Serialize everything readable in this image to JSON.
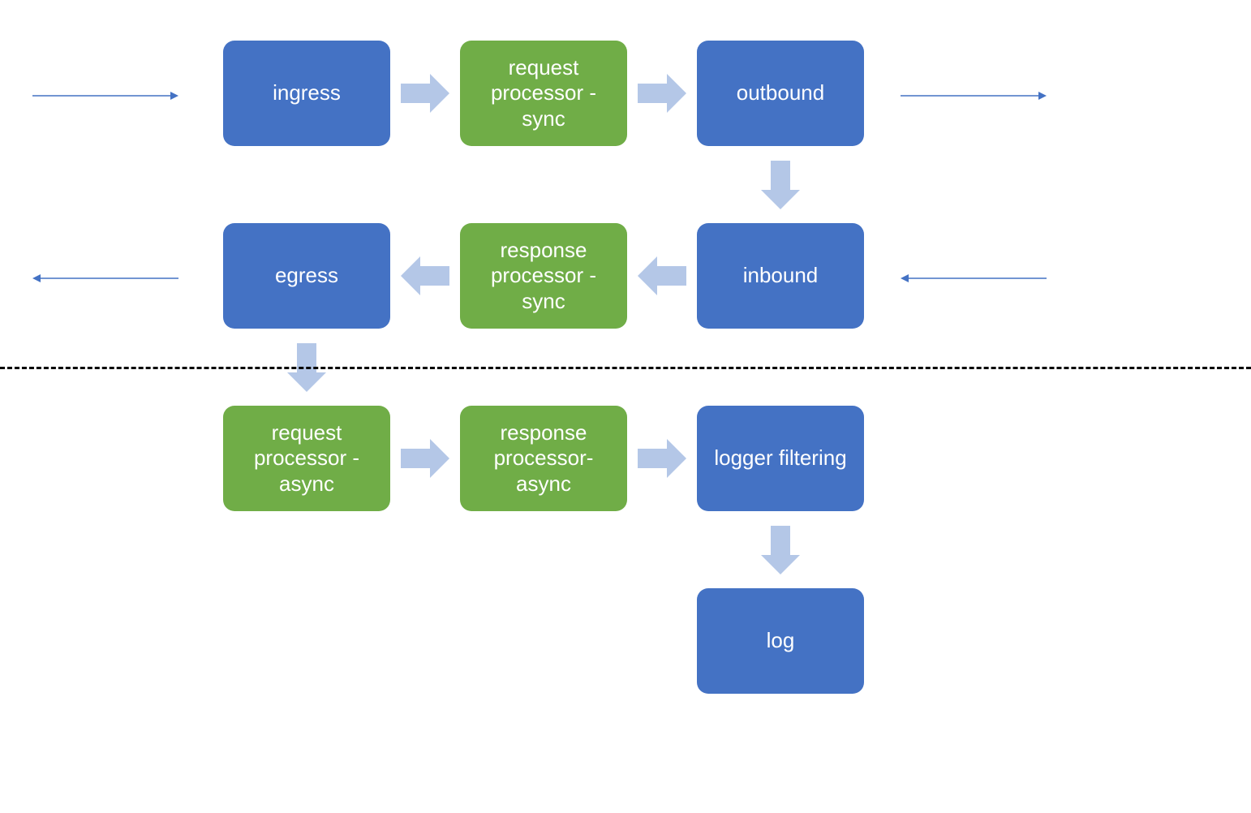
{
  "nodes": {
    "ingress": "ingress",
    "req_sync": "request processor  - sync",
    "outbound": "outbound",
    "inbound": "inbound",
    "resp_sync": "response processor - sync",
    "egress": "egress",
    "req_async": "request processor - async",
    "resp_async": "response processor- async",
    "logger_filtering": "logger filtering",
    "log": "log"
  },
  "colors": {
    "blue": "#4472c4",
    "green": "#70ad47",
    "arrow_fill": "#b4c7e7",
    "thin_arrow": "#4472c4"
  }
}
